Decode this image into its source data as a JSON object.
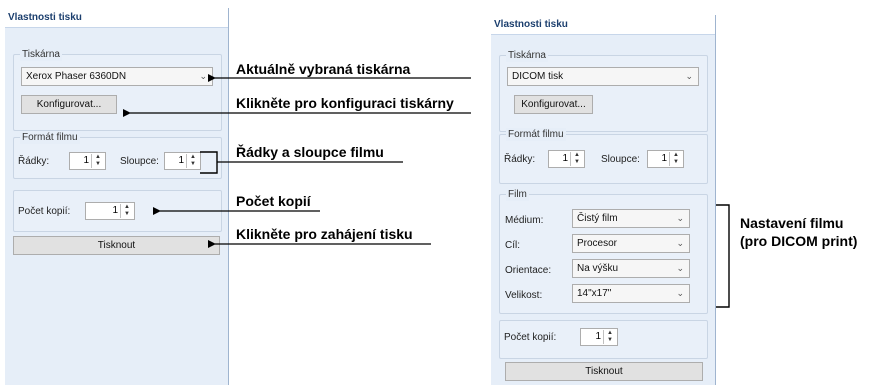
{
  "panel_title": "Vlastnosti tisku",
  "left": {
    "printer_group": "Tiskárna",
    "printer_value": "Xerox Phaser 6360DN",
    "configure_label": "Konfigurovat...",
    "film_format_group": "Formát filmu",
    "rows_label": "Řádky:",
    "rows_value": "1",
    "cols_label": "Sloupce:",
    "cols_value": "1",
    "copies_label": "Počet kopií:",
    "copies_value": "1",
    "print_label": "Tisknout"
  },
  "right": {
    "printer_group": "Tiskárna",
    "printer_value": "DICOM tisk",
    "configure_label": "Konfigurovat...",
    "film_format_group": "Formát filmu",
    "rows_label": "Řádky:",
    "rows_value": "1",
    "cols_label": "Sloupce:",
    "cols_value": "1",
    "film_group": "Film",
    "medium_label": "Médium:",
    "medium_value": "Čistý film",
    "target_label": "Cíl:",
    "target_value": "Procesor",
    "orientation_label": "Orientace:",
    "orientation_value": "Na výšku",
    "size_label": "Velikost:",
    "size_value": "14\"x17\"",
    "copies_label": "Počet kopií:",
    "copies_value": "1",
    "print_label": "Tisknout"
  },
  "annotations": {
    "printer": "Aktuálně vybraná tiskárna",
    "configure": "Klikněte pro konfiguraci tiskárny",
    "rows_cols": "Řádky a sloupce filmu",
    "copies": "Počet kopií",
    "print": "Klikněte pro zahájení tisku",
    "film_line1": "Nastavení filmu",
    "film_line2": "(pro DICOM print)"
  },
  "icons": {
    "dropdown": "chevron-down-icon",
    "spinner": "spin-arrows-icon"
  },
  "colors": {
    "panel_bg": "#e6eef8",
    "title_text": "#1c3f6e"
  }
}
